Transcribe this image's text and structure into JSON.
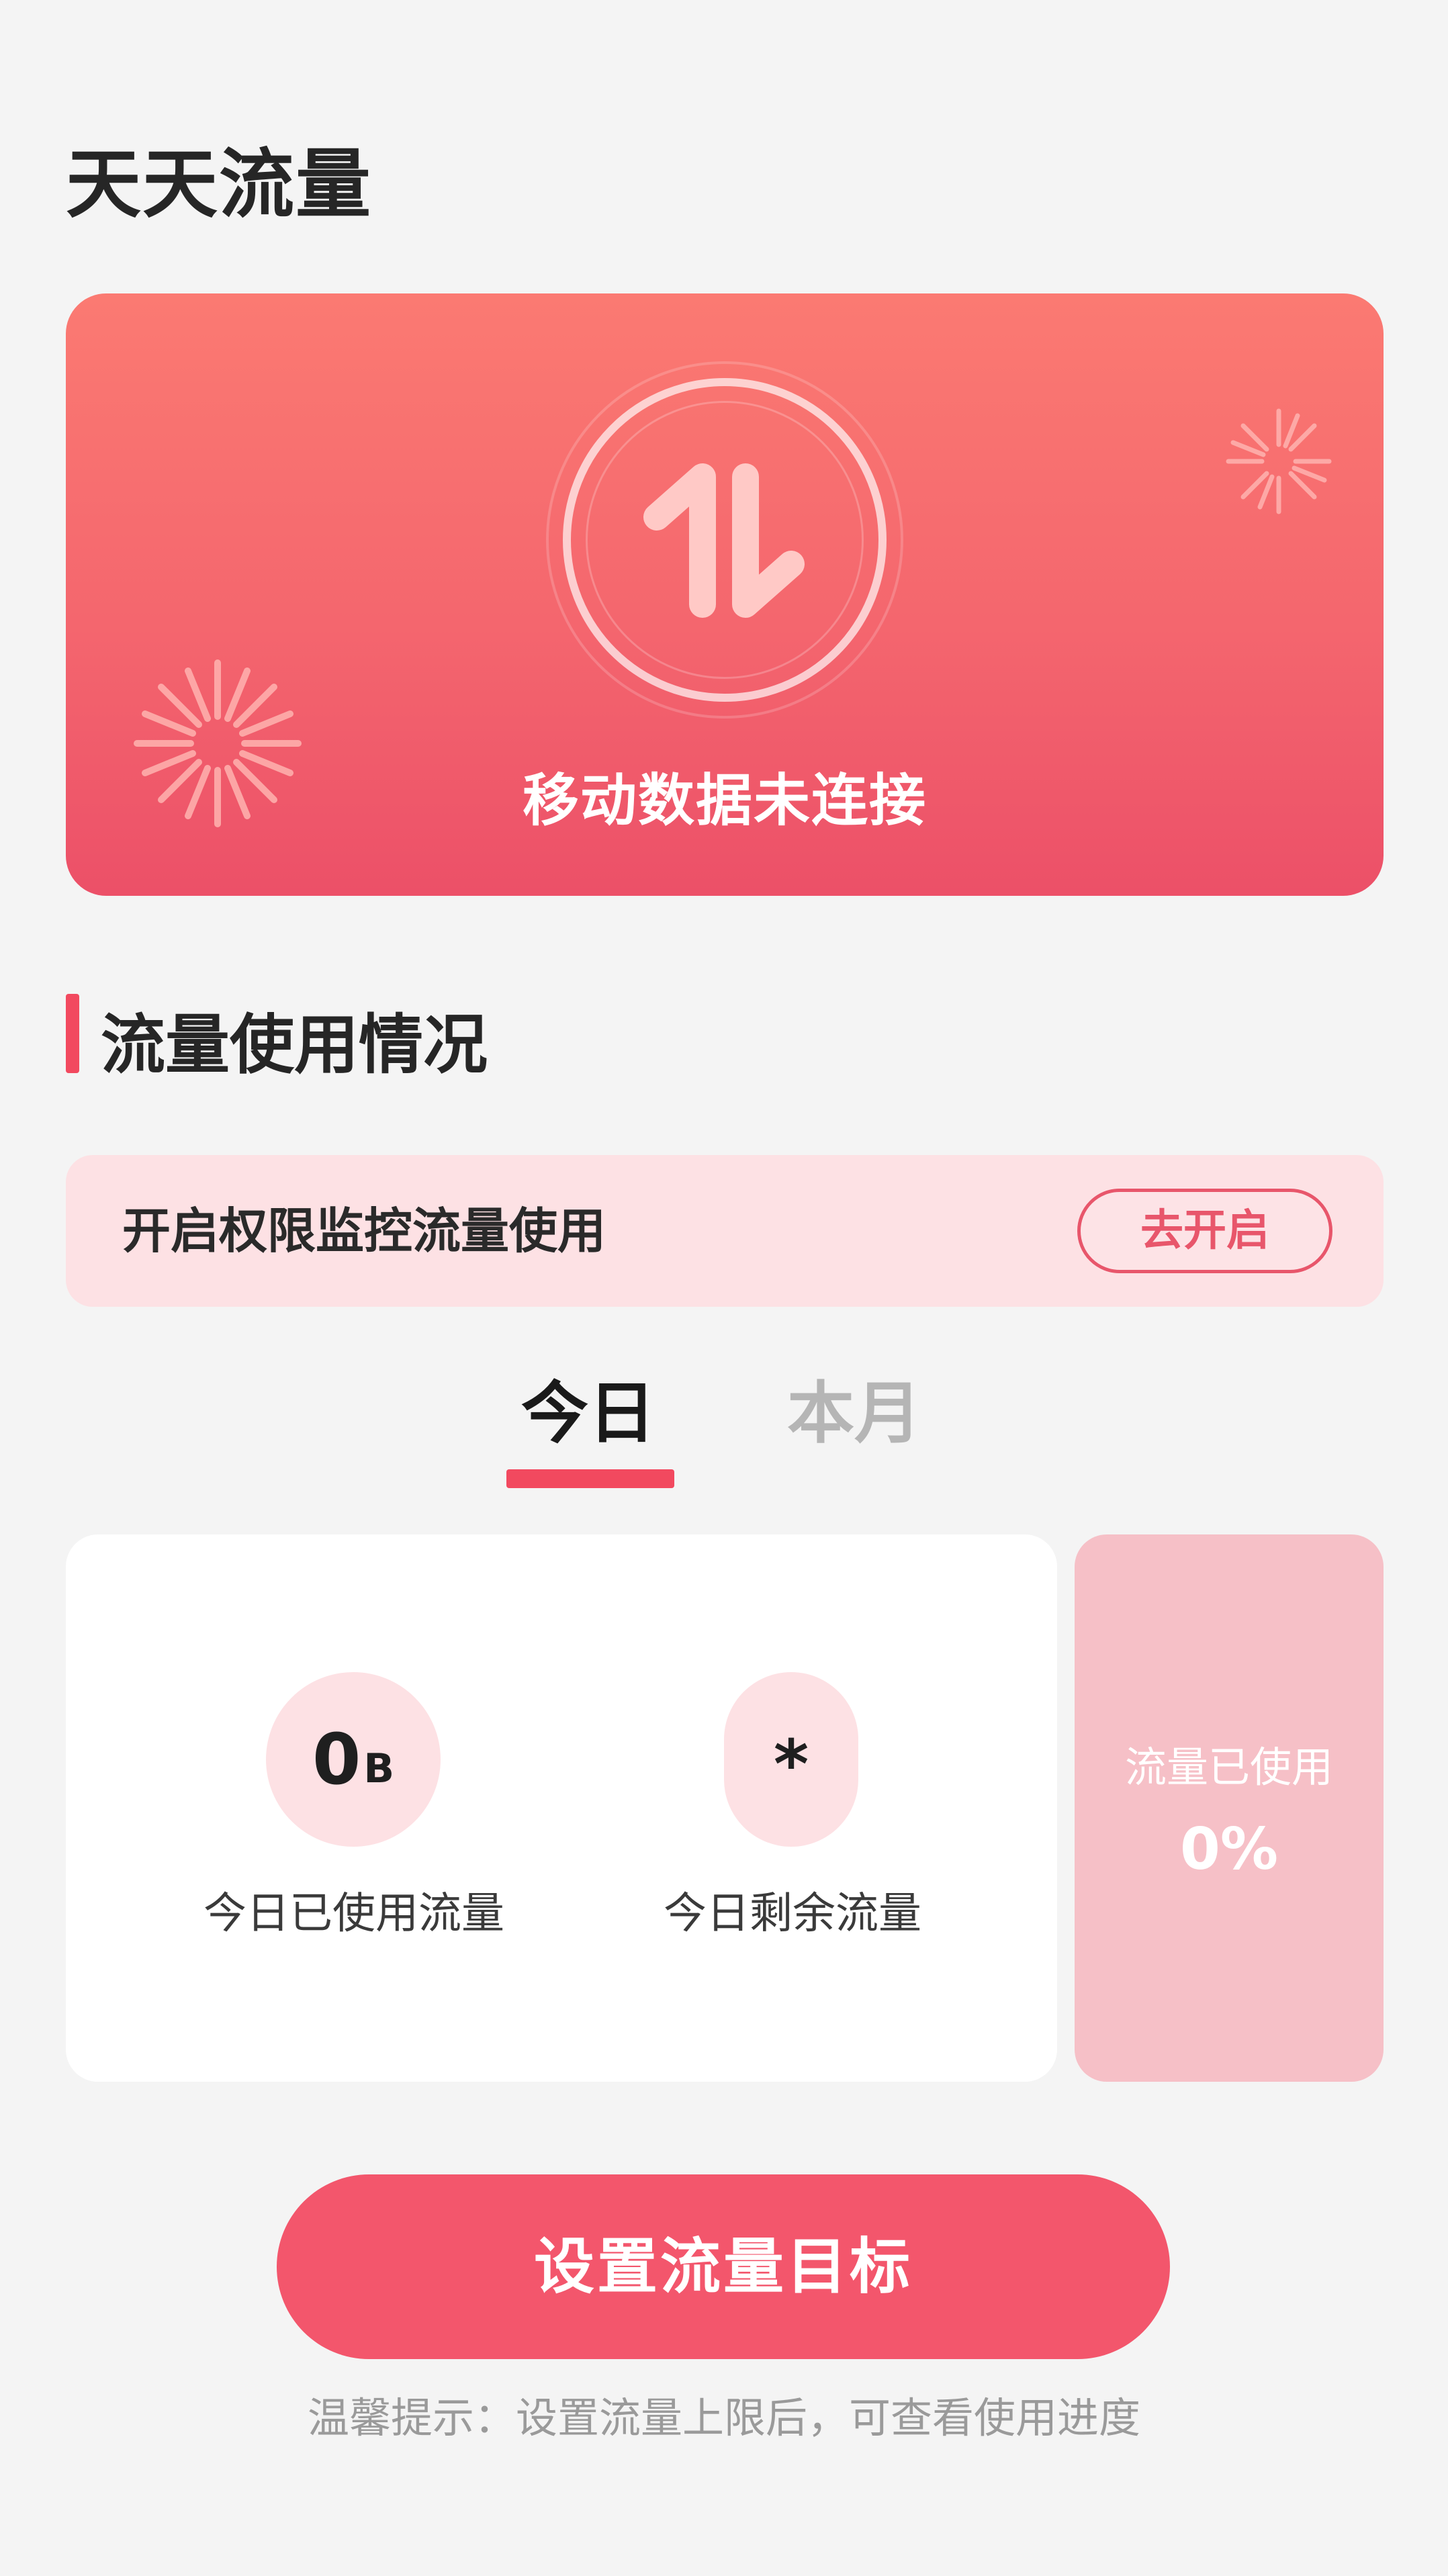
{
  "header": {
    "title": "天天流量"
  },
  "hero": {
    "status": "移动数据未连接",
    "icon": "data-transfer-icon"
  },
  "section": {
    "title": "流量使用情况"
  },
  "permission": {
    "text": "开启权限监控流量使用",
    "button_label": "去开启"
  },
  "tabs": [
    {
      "label": "今日",
      "selected": true
    },
    {
      "label": "本月",
      "selected": false
    }
  ],
  "stats": {
    "used": {
      "value": "0",
      "unit": "B",
      "label": "今日已使用流量"
    },
    "remaining": {
      "value": "*",
      "label": "今日剩余流量"
    }
  },
  "usage": {
    "label": "流量已使用",
    "percent": "0%"
  },
  "actions": {
    "set_goal_label": "设置流量目标"
  },
  "tip": "温馨提示：设置流量上限后，可查看使用进度",
  "colors": {
    "accent": "#f3566c",
    "hero_top": "#fb7a72",
    "hero_bottom": "#ec5068",
    "banner_bg": "#fde1e4",
    "usage_bg": "#f6c0c7",
    "background": "#f4f4f4"
  }
}
